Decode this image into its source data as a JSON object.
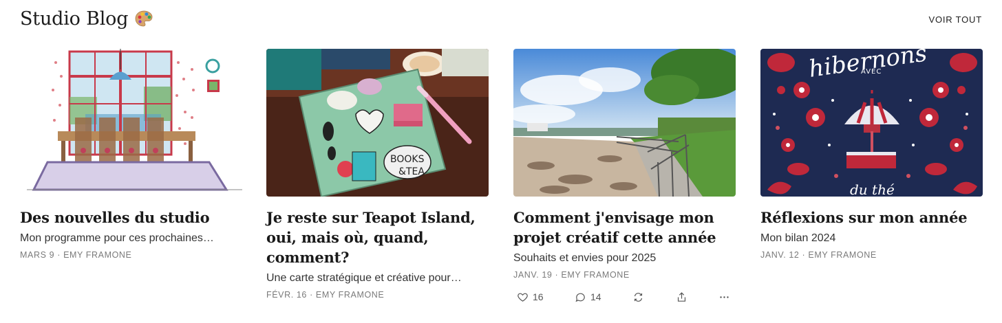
{
  "header": {
    "title": "Studio Blog",
    "title_icon": "palette-emoji",
    "view_all": "VOIR TOUT"
  },
  "posts": [
    {
      "title": "Des nouvelles du studio",
      "subtitle": "Mon programme pour ces prochaines…",
      "date": "MARS 9",
      "author": "EMY FRAMONE",
      "image": "watercolor-dining-room-illustration"
    },
    {
      "title": "Je reste sur Teapot Island, oui, mais où, quand, comment?",
      "subtitle": "Une carte stratégique et créative pour…",
      "date": "FÉVR. 16",
      "author": "EMY FRAMONE",
      "image": "green-notebook-with-stickers-photo"
    },
    {
      "title": "Comment j'envisage mon projet créatif cette année",
      "subtitle": "Souhaits et envies pour 2025",
      "date": "JANV. 19",
      "author": "EMY FRAMONE",
      "image": "seaside-promenade-photo",
      "actions": {
        "likes": "16",
        "comments": "14"
      }
    },
    {
      "title": "Réflexions sur mon année",
      "subtitle": "Mon bilan 2024",
      "date": "JANV. 12",
      "author": "EMY FRAMONE",
      "image": "hibernons-avec-du-the-illustration",
      "image_text": {
        "top": "hibernons",
        "middle": "AVEC",
        "bottom": "du thé"
      }
    }
  ],
  "separator": "·",
  "colors": {
    "text": "#1a1a1a",
    "meta": "#7a7a7a",
    "navy": "#1e2a52",
    "accent_red": "#c0283a"
  }
}
